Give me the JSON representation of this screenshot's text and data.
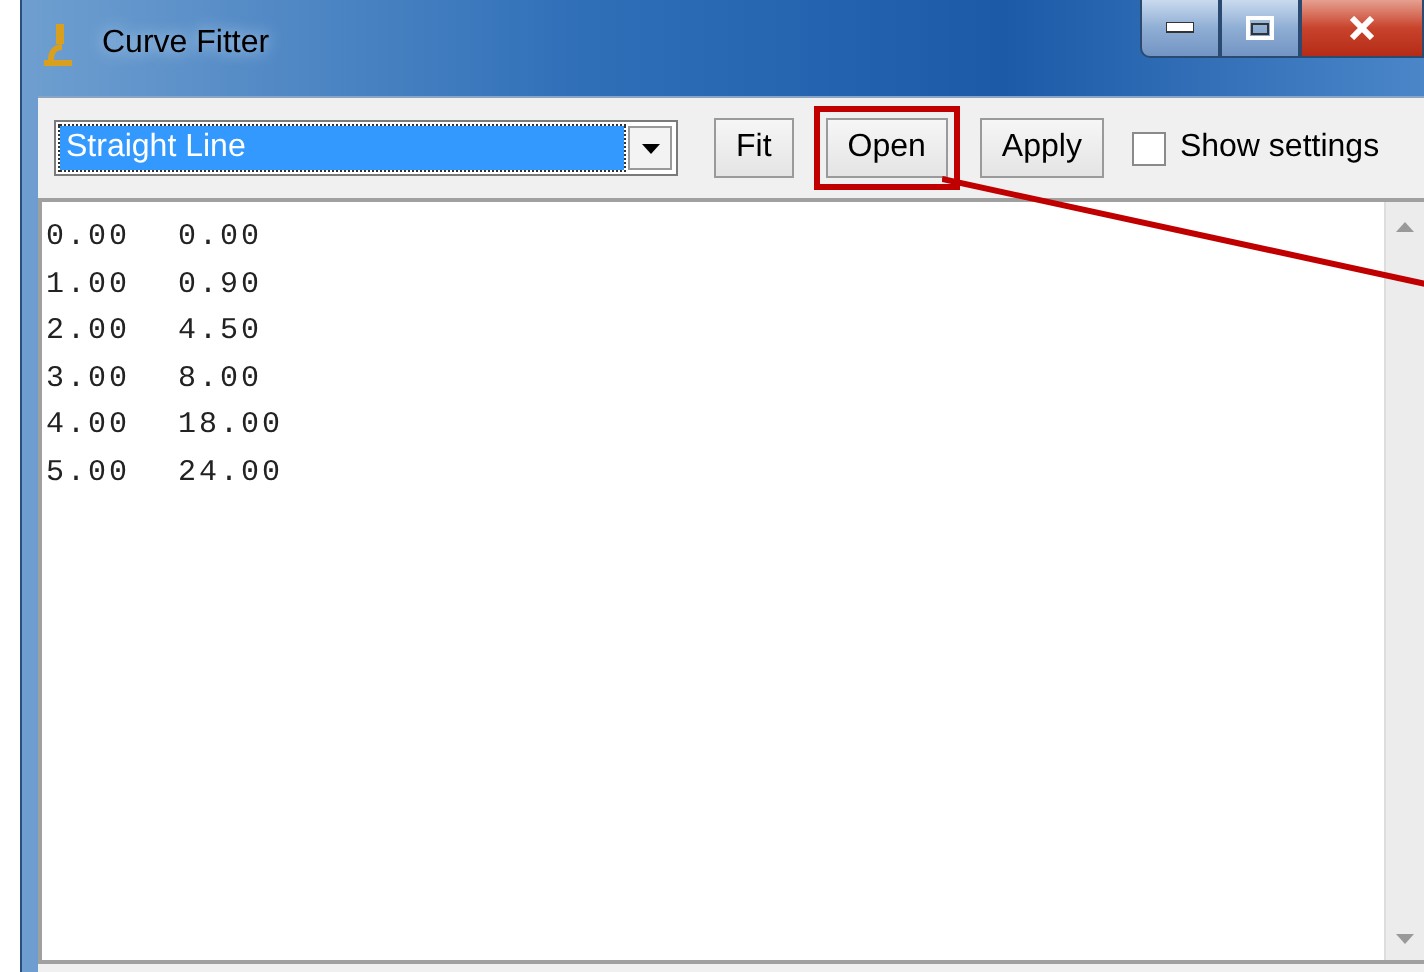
{
  "window": {
    "title": "Curve Fitter"
  },
  "toolbar": {
    "fit_type": {
      "value": "Straight Line"
    },
    "buttons": [
      {
        "label": "Fit",
        "highlighted": false
      },
      {
        "label": "Open",
        "highlighted": true
      },
      {
        "label": "Apply",
        "highlighted": false
      }
    ],
    "show_settings": {
      "label": "Show settings",
      "checked": false
    }
  },
  "data_lines": [
    {
      "cells": [
        "0.00",
        "0.00"
      ]
    },
    {
      "cells": [
        "1.00",
        "0.90"
      ]
    },
    {
      "cells": [
        "2.00",
        "4.50"
      ]
    },
    {
      "cells": [
        "3.00",
        "8.00"
      ]
    },
    {
      "cells": [
        "4.00",
        "18.00"
      ]
    },
    {
      "cells": [
        "5.00",
        "24.00"
      ]
    }
  ]
}
